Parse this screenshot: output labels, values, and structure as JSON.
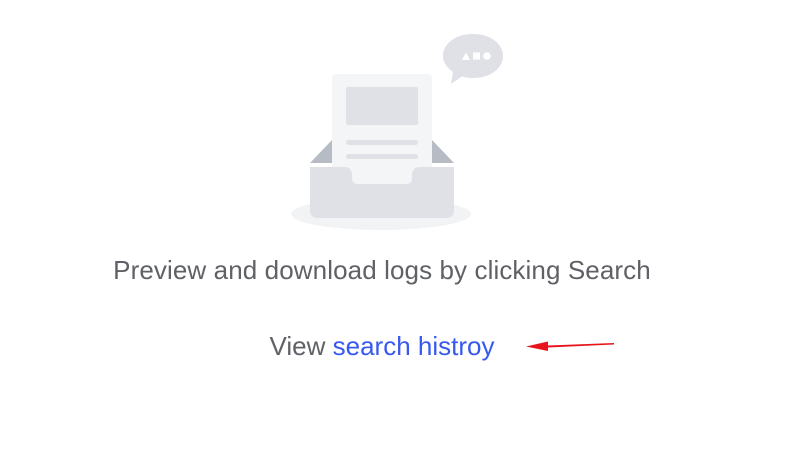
{
  "empty_state": {
    "message": "Preview and download logs by clicking Search",
    "history_prefix": "View",
    "history_link_label": "search histroy"
  },
  "icons": {
    "illustration": "empty-inbox-illustration",
    "bubble": "chat-bubble-icon",
    "annotation": "red-arrow-annotation"
  },
  "colors": {
    "text": "#5f6166",
    "link": "#3759ee",
    "annotation": "#e8141c",
    "illustration_light": "#f4f5f7",
    "illustration_mid": "#dfe1e6",
    "illustration_dark": "#bfc3cb"
  }
}
